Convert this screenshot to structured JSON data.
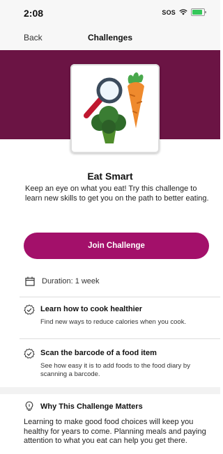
{
  "status_bar": {
    "time": "2:08",
    "sos": "SOS",
    "icons": [
      "wifi-icon",
      "battery-icon"
    ],
    "battery_color": "#34c759"
  },
  "nav": {
    "back_label": "Back",
    "title": "Challenges"
  },
  "hero": {
    "band_color": "#6b1444",
    "image_icons": [
      "magnifying-glass-icon",
      "carrot-icon",
      "broccoli-icon"
    ]
  },
  "challenge": {
    "title": "Eat Smart",
    "description": "Keep an eye on what you eat! Try this challenge to learn new skills to get you on the path to better eating.",
    "join_label": "Join Challenge",
    "join_color": "#a3106a",
    "duration": "Duration: 1 week"
  },
  "steps": [
    {
      "title": "Learn how to cook healthier",
      "description": "Find new ways to reduce calories when you cook."
    },
    {
      "title": "Scan the barcode of a food item",
      "description": "See how easy it is to add foods to the food diary by scanning a barcode."
    }
  ],
  "why": {
    "title": "Why This Challenge Matters",
    "text": "Learning to make good food choices will keep you healthy for years to come. Planning meals and paying attention to what you eat can help you get there."
  }
}
